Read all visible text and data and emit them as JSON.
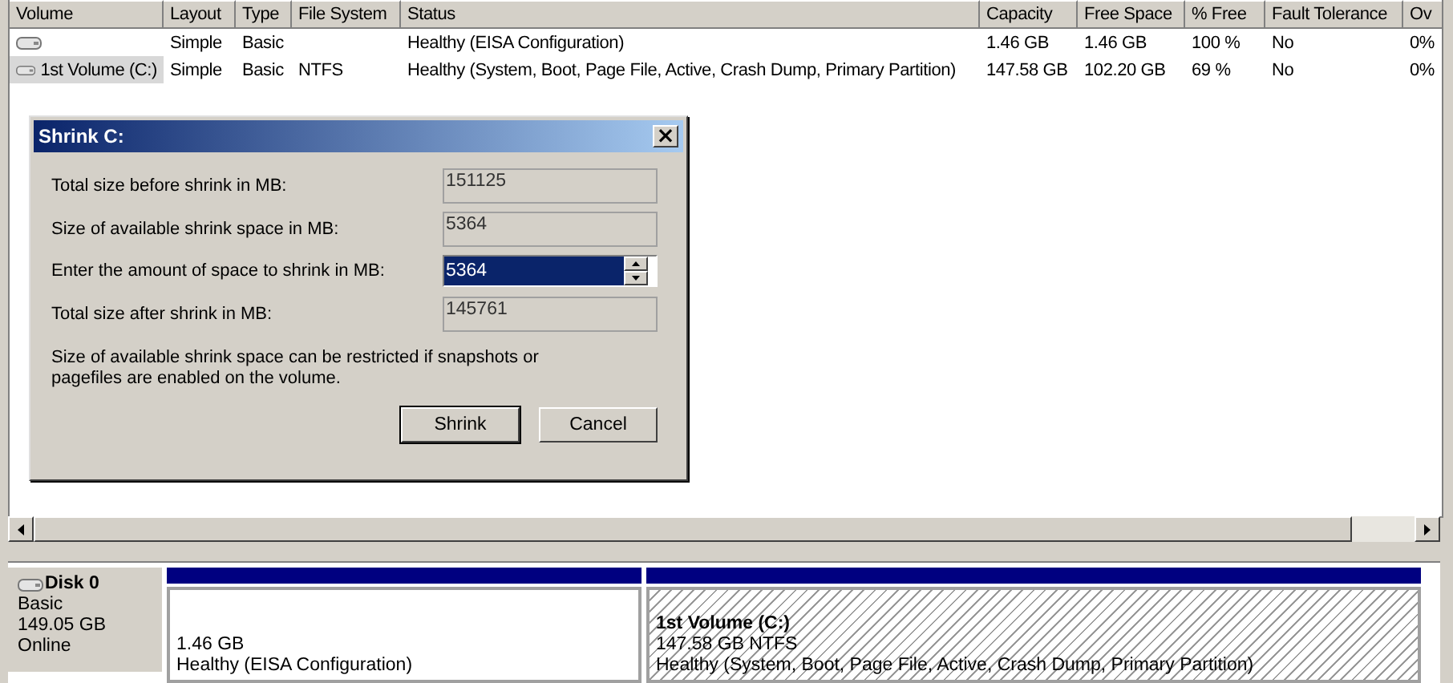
{
  "volume_list": {
    "columns": [
      "Volume",
      "Layout",
      "Type",
      "File System",
      "Status",
      "Capacity",
      "Free Space",
      "% Free",
      "Fault Tolerance",
      "Ov"
    ],
    "rows": [
      {
        "selected": false,
        "cells": [
          "",
          "Simple",
          "Basic",
          "",
          "Healthy (EISA Configuration)",
          "1.46 GB",
          "1.46 GB",
          "100 %",
          "No",
          "0%"
        ]
      },
      {
        "selected": true,
        "cells": [
          "1st Volume (C:)",
          "Simple",
          "Basic",
          "NTFS",
          "Healthy (System, Boot, Page File, Active, Crash Dump, Primary Partition)",
          "147.58 GB",
          "102.20 GB",
          "69 %",
          "No",
          "0%"
        ]
      }
    ]
  },
  "dialog": {
    "title": "Shrink C:",
    "close": "×",
    "fields": [
      {
        "kind": "readonly",
        "label": "Total size before shrink in MB:",
        "value": "151125"
      },
      {
        "kind": "readonly",
        "label": "Size of available shrink space in MB:",
        "value": "5364"
      },
      {
        "kind": "spin",
        "label": "Enter the amount of space to shrink in MB:",
        "value": "5364"
      },
      {
        "kind": "readonly",
        "label": "Total size after shrink in MB:",
        "value": "145761"
      }
    ],
    "note": "Size of available shrink space can be restricted if snapshots or pagefiles are enabled on the volume.",
    "buttons": [
      {
        "label": "Shrink",
        "default": true
      },
      {
        "label": "Cancel",
        "default": false
      }
    ]
  },
  "disk": {
    "name": "Disk 0",
    "type": "Basic",
    "size": "149.05 GB",
    "status": "Online",
    "partitions": [
      {
        "selected": false,
        "lines": [
          "1.46 GB",
          "Healthy (EISA Configuration)"
        ]
      },
      {
        "selected": true,
        "title": "1st Volume  (C:)",
        "lines": [
          "147.58 GB NTFS",
          "Healthy (System, Boot, Page File, Active, Crash Dump, Primary Partition)"
        ]
      }
    ]
  }
}
